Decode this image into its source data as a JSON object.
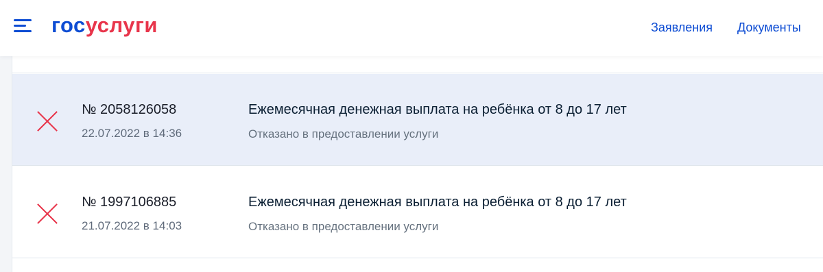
{
  "header": {
    "logo_part1": "гос",
    "logo_part2": "услуги",
    "nav": [
      "Заявления",
      "Документы"
    ]
  },
  "applications": [
    {
      "number": "№ 2058126058",
      "date": "22.07.2022 в 14:36",
      "title": "Ежемесячная денежная выплата на ребёнка от 8 до 17 лет",
      "status": "Отказано в предоставлении услуги"
    },
    {
      "number": "№ 1997106885",
      "date": "21.07.2022 в 14:03",
      "title": "Ежемесячная денежная выплата на ребёнка от 8 до 17 лет",
      "status": "Отказано в предоставлении услуги"
    }
  ],
  "colors": {
    "brand_blue": "#0d4cd3",
    "brand_red": "#e8354b",
    "selected_row_bg": "#e9eef9"
  }
}
